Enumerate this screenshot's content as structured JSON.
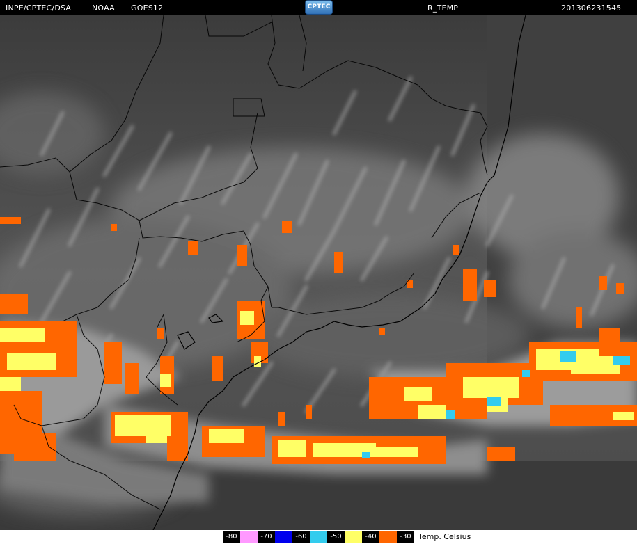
{
  "header": {
    "agency": "INPE/CPTEC/DSA",
    "source": "NOAA",
    "satellite": "GOES12",
    "logo_text": "CPTEC",
    "product": "R_TEMP",
    "timestamp": "201306231545"
  },
  "legend": {
    "title": "Temp. Celsius",
    "items": [
      {
        "label": "-80",
        "color": "#000000"
      },
      {
        "label": "",
        "color": "#ff99ff"
      },
      {
        "label": "-70",
        "color": "#000000"
      },
      {
        "label": "",
        "color": "#0000ee"
      },
      {
        "label": "-60",
        "color": "#000000"
      },
      {
        "label": "",
        "color": "#33ccee"
      },
      {
        "label": "-50",
        "color": "#000000"
      },
      {
        "label": "",
        "color": "#ffff66"
      },
      {
        "label": "-40",
        "color": "#000000"
      },
      {
        "label": "",
        "color": "#ff6600"
      },
      {
        "label": "-30",
        "color": "#000000"
      }
    ]
  },
  "colors": {
    "cold_30": "#ff6600",
    "cold_40": "#ffff66",
    "cold_50": "#33ccee",
    "background_ground": "#3a3a3a"
  }
}
